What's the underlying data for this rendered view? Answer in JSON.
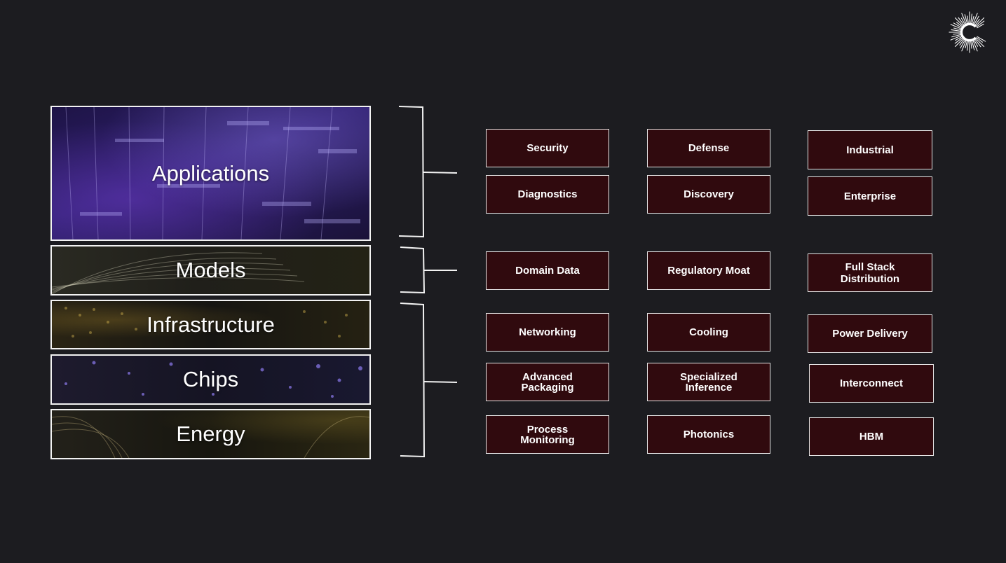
{
  "logo": {
    "icon": "radial-c-logo-icon"
  },
  "layers": [
    {
      "label": "Applications"
    },
    {
      "label": "Models"
    },
    {
      "label": "Infrastructure"
    },
    {
      "label": "Chips"
    },
    {
      "label": "Energy"
    }
  ],
  "boxes": {
    "security": "Security",
    "defense": "Defense",
    "industrial": "Industrial",
    "diagnostics": "Diagnostics",
    "discovery": "Discovery",
    "enterprise": "Enterprise",
    "domain_data": "Domain Data",
    "regulatory_moat": "Regulatory Moat",
    "full_stack_distribution": "Full Stack\nDistribution",
    "networking": "Networking",
    "cooling": "Cooling",
    "power_delivery": "Power Delivery",
    "advanced_packaging": "Advanced\nPackaging",
    "specialized_inference": "Specialized\nInference",
    "interconnect": "Interconnect",
    "process_monitoring": "Process\nMonitoring",
    "photonics": "Photonics",
    "hbm": "HBM"
  },
  "colors": {
    "background": "#1c1c20",
    "box_fill": "#300a0e",
    "border": "#f2f2f2"
  }
}
